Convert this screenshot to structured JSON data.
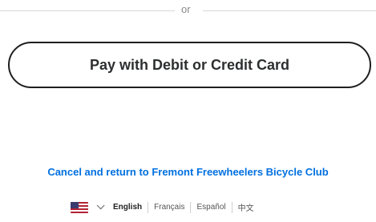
{
  "divider": {
    "or_text": "or"
  },
  "pay_button": {
    "label": "Pay with Debit or Credit Card"
  },
  "cancel_link": {
    "label": "Cancel and return to Fremont Freewheelers Bicycle Club"
  },
  "language_bar": {
    "flag_icon": "us-flag-icon",
    "dropdown_icon": "chevron-down-icon",
    "languages": [
      "English",
      "Français",
      "Español",
      "中文"
    ],
    "active": "English"
  },
  "colors": {
    "link": "#0070e0",
    "button_border": "#1f1f1f"
  }
}
